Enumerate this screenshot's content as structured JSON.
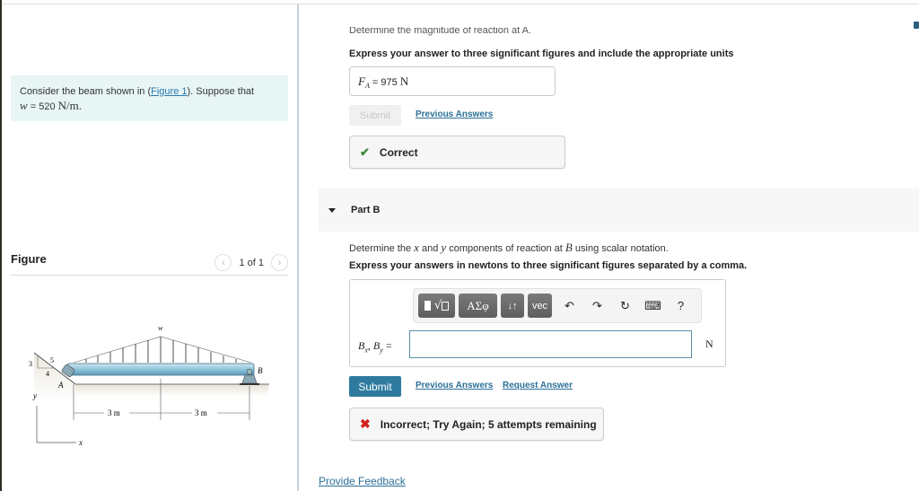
{
  "intro": {
    "text_before": "Consider the beam shown in (",
    "figure_link": "Figure 1",
    "text_after": "). Suppose that",
    "w_symbol": "w",
    "w_eq": " = 520 ",
    "w_units": "N/m."
  },
  "figure_panel": {
    "title": "Figure",
    "pager_text": "1 of 1",
    "prev_icon": "‹",
    "next_icon": "›",
    "diagram": {
      "load_label": "w",
      "slope_labels": [
        "3",
        "4",
        "5"
      ],
      "point_A": "A",
      "point_B": "B",
      "dim_left": "3 m",
      "dim_right": "3 m",
      "axis_y": "y",
      "axis_x": "x"
    }
  },
  "partA": {
    "clipped_prompt": "Determine the magnitude of reaction at A.",
    "instruction": "Express your answer to three significant figures and include the appropriate units",
    "answer_label": "F",
    "answer_sub": "A",
    "answer_eq": " = ",
    "answer_value": "975",
    "answer_unit": "N",
    "submit_label": "Submit",
    "previous_answers_label": "Previous Answers",
    "feedback_icon": "✔",
    "feedback": "Correct",
    "feedback_color": "#3b8a3b"
  },
  "partB": {
    "title": "Part B",
    "question_pre": "Determine the ",
    "question_x": "x",
    "question_mid": " and ",
    "question_y": "y",
    "question_mid2": " components of reaction at ",
    "question_B": "B",
    "question_post": " using scalar notation.",
    "instruction": "Express your answers in newtons to three significant figures separated by a comma.",
    "toolbar": {
      "templates_label": "√",
      "greek_label": "ΑΣφ",
      "arrows_label": "↓↑",
      "vec_label": "vec",
      "undo_icon": "↶",
      "redo_icon": "↷",
      "reset_icon": "↻",
      "keyboard_icon": "⌨",
      "help_icon": "?"
    },
    "lhs_B1": "B",
    "lhs_x": "x",
    "lhs_sep": ", ",
    "lhs_B2": "B",
    "lhs_y": "y",
    "lhs_eq": " =",
    "input_value": "",
    "unit": "N",
    "submit_label": "Submit",
    "previous_answers_label": "Previous Answers",
    "request_answer_label": "Request Answer",
    "feedback_icon": "✖",
    "feedback": "Incorrect; Try Again; 5 attempts remaining",
    "feedback_color": "#d0201c"
  },
  "footer": {
    "provide_feedback": "Provide Feedback"
  },
  "colors": {
    "accent": "#2f7ba0",
    "link": "#2a6f97",
    "intro_bg": "#e8f5f5"
  }
}
